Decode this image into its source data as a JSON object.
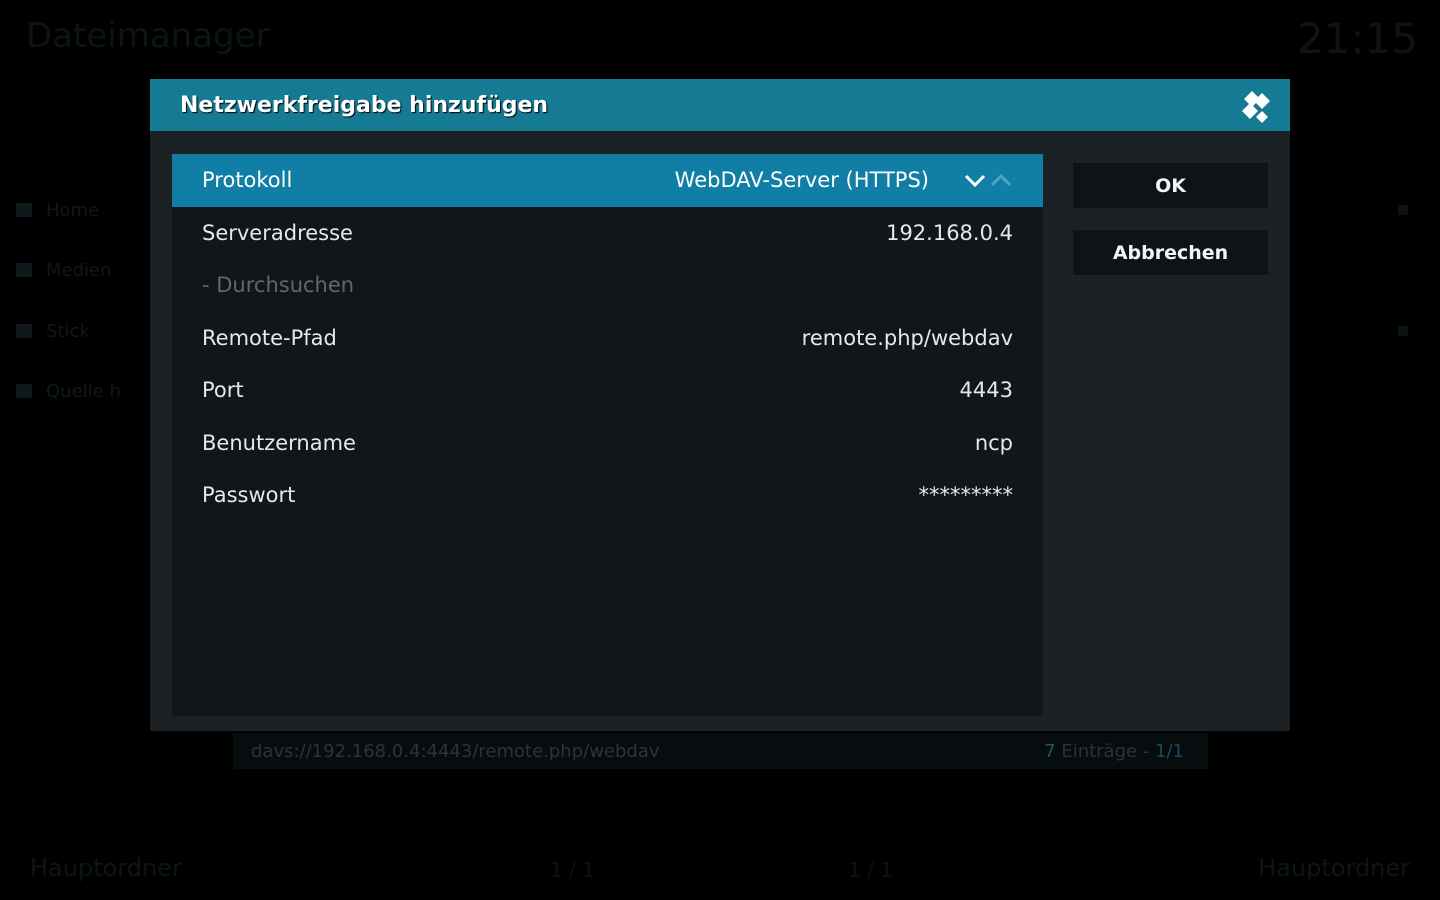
{
  "background": {
    "title": "Dateimanager",
    "clock": "21:15",
    "sources": [
      "Home",
      "Medien",
      "Stick",
      "Quelle h"
    ],
    "status_path": "davs://192.168.0.4:4443/remote.php/webdav",
    "status_count": "7",
    "status_count_suffix": " Einträge - ",
    "status_page": "1/1",
    "footer_left": "Hauptordner",
    "footer_mid1": "1 / 1",
    "footer_mid2": "1 / 1",
    "footer_right": "Hauptordner"
  },
  "dialog": {
    "title": "Netzwerkfreigabe hinzufügen",
    "settings": [
      {
        "label": "Protokoll",
        "value": "WebDAV-Server (HTTPS)"
      },
      {
        "label": "Serveradresse",
        "value": "192.168.0.4"
      },
      {
        "label": "- Durchsuchen",
        "value": ""
      },
      {
        "label": "Remote-Pfad",
        "value": "remote.php/webdav"
      },
      {
        "label": "Port",
        "value": "4443"
      },
      {
        "label": "Benutzername",
        "value": "ncp"
      },
      {
        "label": "Passwort",
        "value": "*********"
      }
    ],
    "ok_label": "OK",
    "cancel_label": "Abbrechen"
  },
  "colors": {
    "header": "#157a94",
    "selected_row": "#117fa5",
    "dialog_bg": "#1b2124",
    "panel_bg": "#121618"
  },
  "icons": {
    "logo": "kodi-logo-icon",
    "spin_down": "chevron-down-icon",
    "spin_up": "chevron-up-icon"
  }
}
